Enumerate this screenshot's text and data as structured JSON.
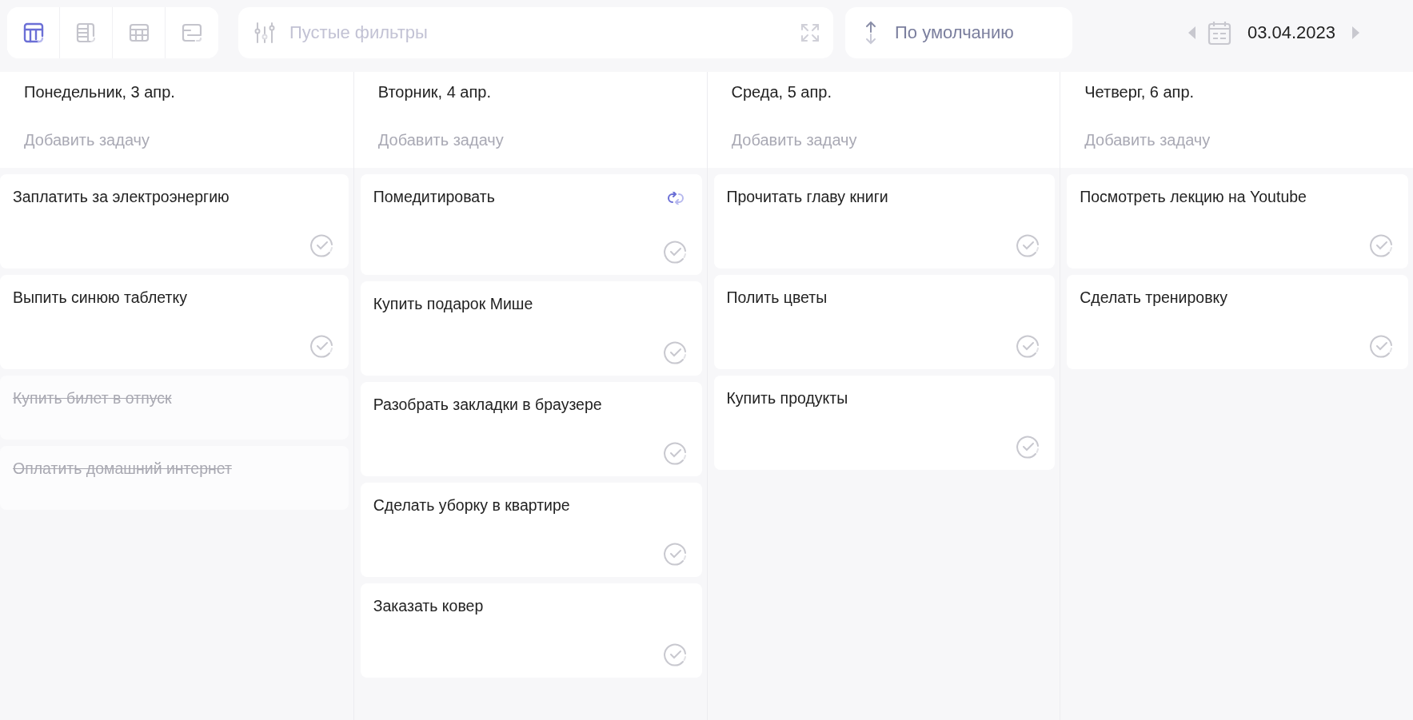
{
  "view_modes": [
    {
      "kind": "board",
      "selected": true
    },
    {
      "kind": "list",
      "selected": false
    },
    {
      "kind": "table",
      "selected": false
    },
    {
      "kind": "timeline",
      "selected": false
    }
  ],
  "filter": {
    "placeholder": "Пустые фильтры"
  },
  "sort": {
    "label": "По умолчанию"
  },
  "date": {
    "value": "03.04.2023"
  },
  "columns": [
    {
      "title": "Понедельник, 3 апр.",
      "add_task": {
        "placeholder": "Добавить задачу"
      },
      "tasks": [
        {
          "title": "Заплатить за электроэнергию",
          "done": false,
          "repeating": false
        },
        {
          "title": "Выпить синюю таблетку",
          "done": false,
          "repeating": false
        },
        {
          "title": "Купить билет в отпуск",
          "done": true,
          "repeating": false
        },
        {
          "title": "Оплатить домашний интернет",
          "done": true,
          "repeating": false
        }
      ]
    },
    {
      "title": "Вторник, 4 апр.",
      "add_task": {
        "placeholder": "Добавить задачу"
      },
      "tasks": [
        {
          "title": "Помедитировать",
          "done": false,
          "repeating": true
        },
        {
          "title": "Купить подарок Мише",
          "done": false,
          "repeating": false
        },
        {
          "title": "Разобрать закладки в браузере",
          "done": false,
          "repeating": false
        },
        {
          "title": "Сделать уборку в квартире",
          "done": false,
          "repeating": false
        },
        {
          "title": "Заказать ковер",
          "done": false,
          "repeating": false
        }
      ]
    },
    {
      "title": "Среда, 5 апр.",
      "add_task": {
        "placeholder": "Добавить задачу"
      },
      "tasks": [
        {
          "title": "Прочитать главу книги",
          "done": false,
          "repeating": false
        },
        {
          "title": "Полить цветы",
          "done": false,
          "repeating": false
        },
        {
          "title": "Купить продукты",
          "done": false,
          "repeating": false
        }
      ]
    },
    {
      "title": "Четверг, 6 апр.",
      "add_task": {
        "placeholder": "Добавить задачу"
      },
      "tasks": [
        {
          "title": "Посмотреть лекцию на Youtube",
          "done": false,
          "repeating": false
        },
        {
          "title": "Сделать тренировку",
          "done": false,
          "repeating": false
        }
      ]
    }
  ]
}
